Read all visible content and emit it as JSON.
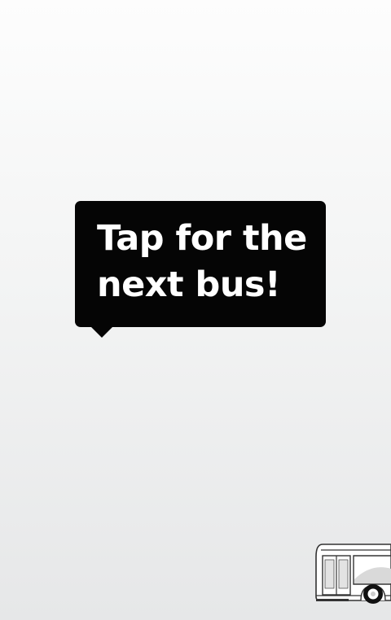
{
  "prompt": {
    "line1": "Tap for the",
    "line2": "next bus!"
  },
  "icons": {
    "bus": "bus-icon"
  },
  "colors": {
    "bubble": "#050505",
    "bubble_text": "#ffffff",
    "background_top": "#fdfdfd",
    "background_bottom": "#e6e7e8"
  }
}
